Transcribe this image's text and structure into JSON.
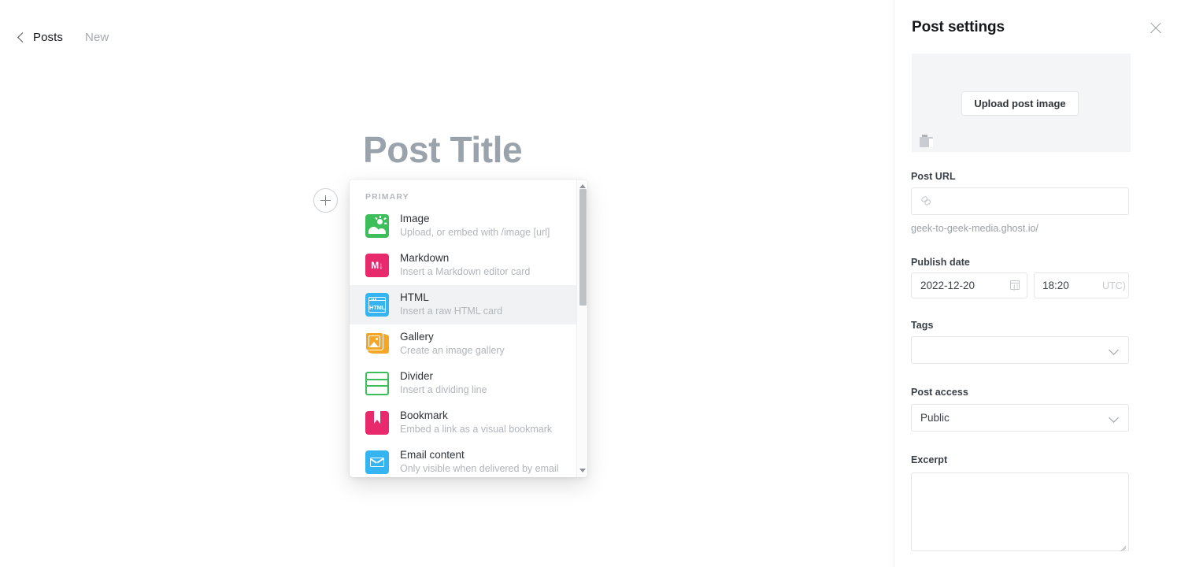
{
  "breadcrumb": {
    "back_icon": "chevron-left-icon",
    "parent": "Posts",
    "current": "New"
  },
  "editor": {
    "title_placeholder": "Post Title",
    "add_card_icon": "plus-icon"
  },
  "card_menu": {
    "section_label": "PRIMARY",
    "selected_item": "HTML",
    "scrollbar": {
      "up_arrow_icon": "triangle-up-icon",
      "down_arrow_icon": "triangle-down-icon"
    },
    "items": [
      {
        "title": "Image",
        "desc": "Upload, or embed with /image [url]",
        "icon": "image-card-icon",
        "color": "#3cbe5a"
      },
      {
        "title": "Markdown",
        "desc": "Insert a Markdown editor card",
        "icon": "markdown-card-icon",
        "color": "#e8296b"
      },
      {
        "title": "HTML",
        "desc": "Insert a raw HTML card",
        "icon": "html-card-icon",
        "color": "#34b4f0"
      },
      {
        "title": "Gallery",
        "desc": "Create an image gallery",
        "icon": "gallery-card-icon",
        "color": "#f5a623"
      },
      {
        "title": "Divider",
        "desc": "Insert a dividing line",
        "icon": "divider-card-icon",
        "color": "#3cbe5a"
      },
      {
        "title": "Bookmark",
        "desc": "Embed a link as a visual bookmark",
        "icon": "bookmark-card-icon",
        "color": "#e8296b"
      },
      {
        "title": "Email content",
        "desc": "Only visible when delivered by email",
        "icon": "email-card-icon",
        "color": "#34b4f0"
      }
    ]
  },
  "panel": {
    "title": "Post settings",
    "close_icon": "close-icon",
    "feature_image": {
      "upload_label": "Upload post image",
      "placeholder_icon": "broken-image-icon"
    },
    "post_url": {
      "label": "Post URL",
      "value": "",
      "icon": "link-icon",
      "hint": "geek-to-geek-media.ghost.io/"
    },
    "publish_date": {
      "label": "Publish date",
      "date_value": "2022-12-20",
      "date_icon": "calendar-icon",
      "time_value": "18:20",
      "timezone_suffix": "UTC)"
    },
    "tags": {
      "label": "Tags",
      "value": "",
      "chevron_icon": "chevron-down-icon"
    },
    "post_access": {
      "label": "Post access",
      "value": "Public",
      "chevron_icon": "chevron-down-icon"
    },
    "excerpt": {
      "label": "Excerpt",
      "value": "",
      "resize_icon": "resize-grip-icon"
    }
  }
}
